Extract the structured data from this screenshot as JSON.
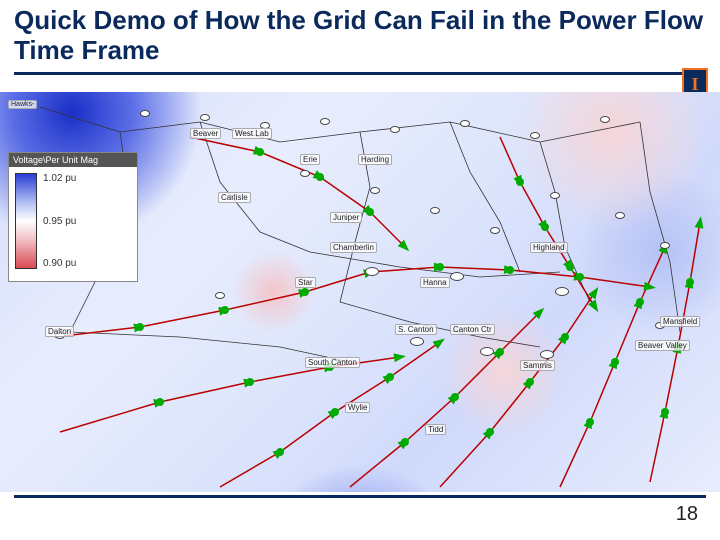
{
  "title": "Quick Demo of How the Grid Can Fail in the Power Flow Time Frame",
  "logo": "I",
  "page_number": "18",
  "legend": {
    "title": "Voltage\\Per Unit Mag",
    "ticks": [
      "1.02 pu",
      "0.95 pu",
      "0.90 pu"
    ]
  },
  "nodes": {
    "hawks": "Hawks-",
    "beaver": "Beaver",
    "west_lab": "West Lab",
    "erie": "Erie",
    "harding": "Harding",
    "carlisle": "Carlisle",
    "juniper": "Juniper",
    "chamberlin": "Chamberlin",
    "highland": "Highland",
    "star": "Star",
    "hanna": "Hanna",
    "s_canton": "S. Canton",
    "canton_ctr": "Canton Ctr",
    "south_canton": "South Canton",
    "sammis": "Sammis",
    "tidd": "Tidd",
    "wylie": "Wylie",
    "dalton": "Dalton",
    "mansfield": "Mansfield",
    "beaver_valley": "Beaver Valley"
  }
}
